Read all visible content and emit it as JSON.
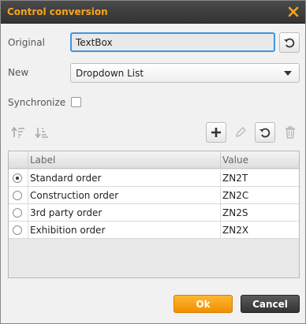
{
  "dialog": {
    "title": "Control conversion",
    "original_label": "Original",
    "original_value": "TextBox",
    "new_label": "New",
    "new_value": "Dropdown List",
    "synchronize_label": "Synchronize",
    "synchronize_checked": false
  },
  "toolbar": {
    "left_icons": [
      "move-up-icon",
      "move-down-icon"
    ],
    "right_icons": [
      "plus-icon",
      "pencil-icon",
      "undo-icon",
      "trash-icon"
    ]
  },
  "grid": {
    "columns": [
      "Label",
      "Value"
    ],
    "rows": [
      {
        "label": "Standard order",
        "value": "ZN2T",
        "selected": true
      },
      {
        "label": "Construction order",
        "value": "ZN2C",
        "selected": false
      },
      {
        "label": "3rd party order",
        "value": "ZN2S",
        "selected": false
      },
      {
        "label": "Exhibition order",
        "value": "ZN2X",
        "selected": false
      }
    ]
  },
  "buttons": {
    "ok": "Ok",
    "cancel": "Cancel"
  },
  "colors": {
    "title": "#f7a51b",
    "accent_border": "#3d97e0",
    "ok_button": "#f39a0f",
    "cancel_button": "#444444"
  }
}
